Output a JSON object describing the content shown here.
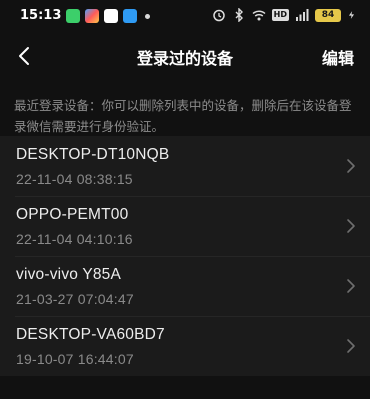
{
  "status_bar": {
    "time": "15:13",
    "battery": "84",
    "network_badge": "HD",
    "accent_battery": "#e6c84a"
  },
  "header": {
    "title": "登录过的设备",
    "edit_label": "编辑"
  },
  "description": "最近登录设备：你可以删除列表中的设备，删除后在该设备登录微信需要进行身份验证。",
  "devices": [
    {
      "name": "DESKTOP-DT10NQB",
      "time": "22-11-04 08:38:15"
    },
    {
      "name": "OPPO-PEMT00",
      "time": "22-11-04 04:10:16"
    },
    {
      "name": "vivo-vivo Y85A",
      "time": "21-03-27 07:04:47"
    },
    {
      "name": "DESKTOP-VA60BD7",
      "time": "19-10-07 16:44:07"
    }
  ]
}
